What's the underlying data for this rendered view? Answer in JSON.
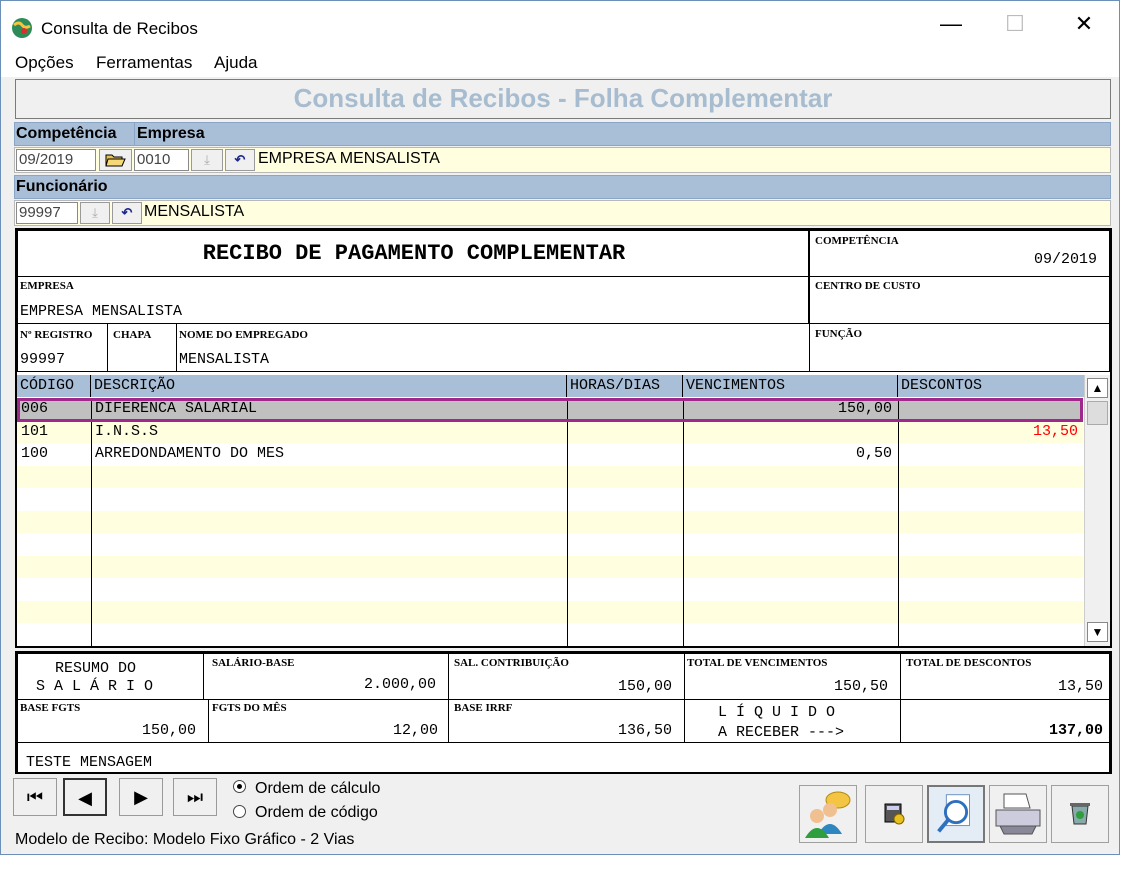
{
  "window": {
    "title": "Consulta de Recibos",
    "controls": {
      "minimize": "—",
      "maximize": "☐",
      "close": "✕"
    }
  },
  "menu": [
    "Opções",
    "Ferramentas",
    "Ajuda"
  ],
  "header": {
    "title": "Consulta de Recibos - Folha Complementar"
  },
  "filters": {
    "competencia_label": "Competência",
    "empresa_label": "Empresa",
    "competencia_value": "09/2019",
    "empresa_code": "0010",
    "empresa_name": "EMPRESA MENSALISTA",
    "funcionario_label": "Funcionário",
    "funcionario_code": "99997",
    "funcionario_name": "MENSALISTA"
  },
  "receipt": {
    "title": "RECIBO DE PAGAMENTO COMPLEMENTAR",
    "competencia_label": "COMPETÊNCIA",
    "competencia_value": "09/2019",
    "empresa_label": "EMPRESA",
    "empresa_value": "EMPRESA MENSALISTA",
    "centro_label": "CENTRO DE CUSTO",
    "registro_label": "Nº REGISTRO",
    "registro_value": "99997",
    "chapa_label": "CHAPA",
    "nome_label": "NOME DO EMPREGADO",
    "nome_value": "MENSALISTA",
    "funcao_label": "FUNÇÃO",
    "columns": [
      "CÓDIGO",
      "DESCRIÇÃO",
      "HORAS/DIAS",
      "VENCIMENTOS",
      "DESCONTOS"
    ],
    "rows": [
      {
        "codigo": "006",
        "descricao": "DIFERENCA SALARIAL",
        "horas": "",
        "vencimentos": "150,00",
        "descontos": ""
      },
      {
        "codigo": "101",
        "descricao": "I.N.S.S",
        "horas": "",
        "vencimentos": "",
        "descontos": "13,50"
      },
      {
        "codigo": "100",
        "descricao": "ARREDONDAMENTO DO MES",
        "horas": "",
        "vencimentos": "0,50",
        "descontos": ""
      }
    ],
    "desconto_color": "#ff0000",
    "selected_row_color": "#a0288c"
  },
  "summary": {
    "resumo_line1": "RESUMO DO",
    "resumo_line2": "S A L Á R I O",
    "salario_base_label": "SALÁRIO-BASE",
    "salario_base_value": "2.000,00",
    "sal_contrib_label": "SAL. CONTRIBUIÇÃO",
    "sal_contrib_value": "150,00",
    "total_venc_label": "TOTAL DE VENCIMENTOS",
    "total_venc_value": "150,50",
    "total_desc_label": "TOTAL DE DESCONTOS",
    "total_desc_value": "13,50",
    "base_fgts_label": "BASE FGTS",
    "base_fgts_value": "150,00",
    "fgts_mes_label": "FGTS DO MÊS",
    "fgts_mes_value": "12,00",
    "base_irrf_label": "BASE IRRF",
    "base_irrf_value": "136,50",
    "liquido_line1": "L Í Q U I D O",
    "liquido_line2": "A RECEBER --->",
    "liquido_value": "137,00",
    "mensagem": "TESTE MENSAGEM"
  },
  "nav": {
    "first": "⏮",
    "prev": "◀",
    "next": "▶",
    "last": "⏭",
    "ordem_calculo": "Ordem de cálculo",
    "ordem_codigo": "Ordem de código"
  },
  "status": "Modelo de Recibo: Modelo Fixo Gráfico - 2 Vias"
}
